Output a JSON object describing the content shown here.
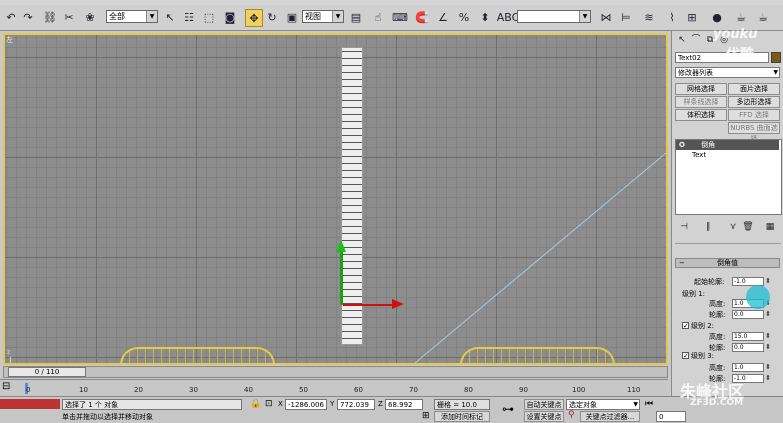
{
  "toolbar": {
    "selection_filter": "全部",
    "reference_coord": "视图",
    "named_selection": ""
  },
  "viewport": {
    "label": "左"
  },
  "panel": {
    "object_name": "Text02",
    "object_color": "#7a5c10",
    "modifier_list": "修改器列表",
    "buttons": [
      "网格选择",
      "面片选择",
      "样条线选择",
      "多边形选择",
      "体积选择",
      "FFD 选择",
      "NURBS 曲面选择"
    ],
    "stack": [
      "倒角",
      "Text"
    ],
    "rollout_title": "倒角值",
    "start_outline_label": "起始轮廓:",
    "start_outline_value": "-1.0",
    "level1_label": "级别 1:",
    "level2_label": "级别 2:",
    "level3_label": "级别 3:",
    "height_label": "高度:",
    "outline_label": "轮廓:",
    "l1_height": "1.0",
    "l1_outline": "0.0",
    "l2_height": "15.0",
    "l2_outline": "0.0",
    "l3_height": "1.0",
    "l3_outline": "-1.0"
  },
  "timeline": {
    "slider_text": "0 / 110",
    "ticks": [
      "0",
      "10",
      "20",
      "30",
      "40",
      "50",
      "60",
      "70",
      "80",
      "90",
      "100",
      "110"
    ]
  },
  "status": {
    "selected": "选择了 1 个 对象",
    "prompt": "单击并拖动以选择并移动对象",
    "x_label": "X",
    "x_value": "-1286.006",
    "y_label": "Y",
    "y_value": "772.039",
    "z_label": "Z",
    "z_value": "68.992",
    "grid": "栅格 = 10.0",
    "add_time_tag": "添加时间标记",
    "auto_key": "自动关键点",
    "selected_object": "选定对象",
    "set_key": "设置关键点",
    "key_filters": "关键点过滤器...",
    "frame": "0"
  },
  "watermarks": {
    "youku": "youku",
    "youku_cn": "优酷",
    "site": "朱峰社区",
    "site_url": "ZF3D.COM"
  }
}
